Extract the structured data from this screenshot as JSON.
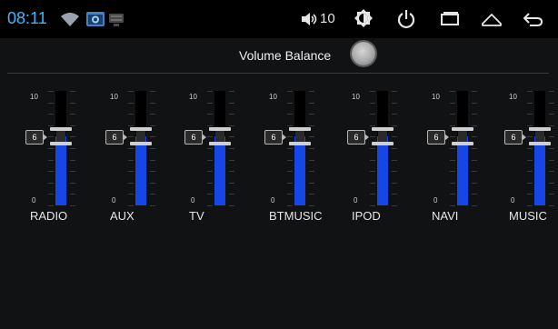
{
  "status_bar": {
    "time": "08:11",
    "volume_level": "10",
    "icons": [
      "wifi-icon",
      "screenshot-icon",
      "keyboard-icon",
      "speaker-icon",
      "brightness-icon",
      "power-icon",
      "recent-apps-icon",
      "home-icon",
      "back-icon"
    ]
  },
  "header": {
    "title": "Volume Balance",
    "toggle_color": "#b5b5b5"
  },
  "equalizer": {
    "scale_max": "10",
    "scale_min": "0",
    "fill_color": "#1646e6",
    "channels": [
      {
        "label": "RADIO",
        "value": "6"
      },
      {
        "label": "AUX",
        "value": "6"
      },
      {
        "label": "TV",
        "value": "6"
      },
      {
        "label": "BTMUSIC",
        "value": "6"
      },
      {
        "label": "IPOD",
        "value": "6"
      },
      {
        "label": "NAVI",
        "value": "6"
      },
      {
        "label": "MUSIC",
        "value": "6"
      }
    ]
  }
}
